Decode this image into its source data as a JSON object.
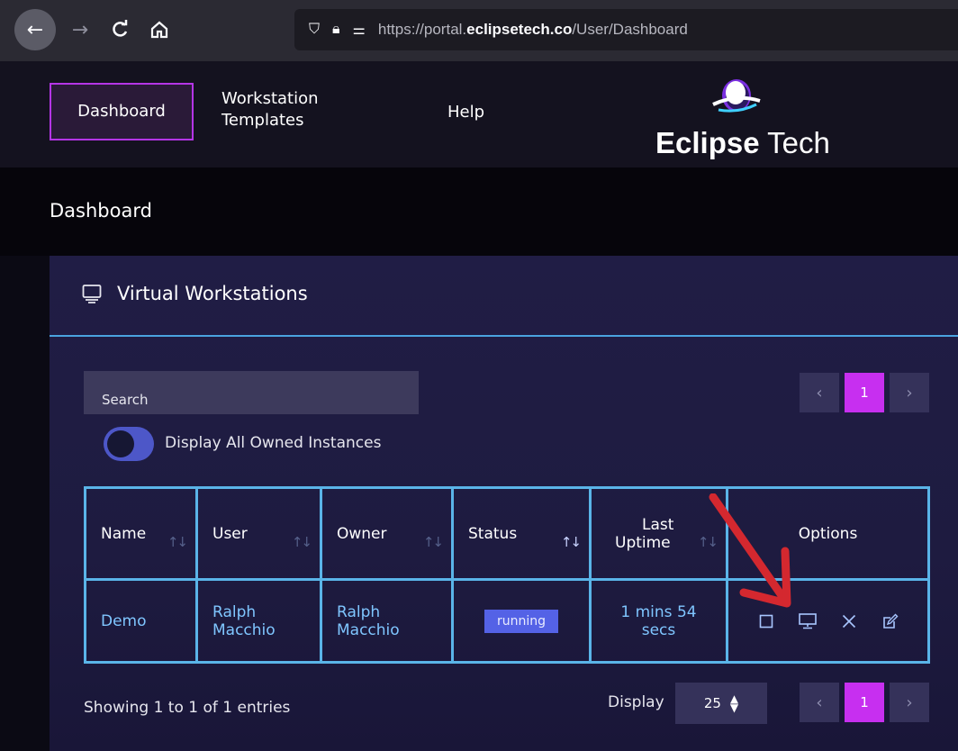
{
  "browser": {
    "url_prefix": "https://portal.",
    "url_domain": "eclipsetech.co",
    "url_path": "/User/Dashboard"
  },
  "nav": {
    "dashboard": "Dashboard",
    "templates_line1": "Workstation",
    "templates_line2": "Templates",
    "help": "Help"
  },
  "logo": {
    "bold": "Eclipse",
    "rest": " Tech"
  },
  "page": {
    "title": "Dashboard"
  },
  "card": {
    "title": "Virtual Workstations",
    "search_placeholder": "Search",
    "toggle_label": "Display All Owned Instances",
    "pager": {
      "prev": "‹",
      "current": "1",
      "next": "›"
    }
  },
  "table": {
    "headers": [
      "Name",
      "User",
      "Owner",
      "Status",
      "Last Uptime",
      "Options"
    ],
    "header_uptime_line1": "Last",
    "header_uptime_line2": "Uptime",
    "rows": [
      {
        "name": "Demo",
        "user_line1": "Ralph",
        "user_line2": "Macchio",
        "owner_line1": "Ralph",
        "owner_line2": "Macchio",
        "status": "running",
        "uptime_line1": "1 mins 54",
        "uptime_line2": "secs"
      }
    ]
  },
  "footer": {
    "entries": "Showing 1 to 1 of 1 entries",
    "display_label": "Display",
    "display_value": "25"
  },
  "colors": {
    "accent": "#c72ff0",
    "border": "#5ab4e8",
    "status": "#5462e6",
    "annotation_arrow": "#d4282f"
  }
}
